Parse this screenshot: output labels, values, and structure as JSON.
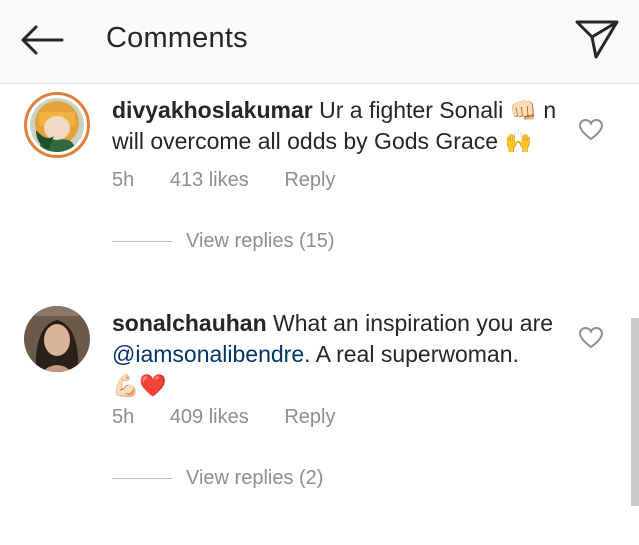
{
  "header": {
    "title": "Comments"
  },
  "comments": [
    {
      "username": "divyakhoslakumar",
      "text_before": "Ur a fighter Sonali ",
      "emoji1": "👊🏻",
      "text_after": " n will overcome all odds by Gods Grace ",
      "emoji2": "🙌",
      "time": "5h",
      "likes": "413 likes",
      "reply": "Reply",
      "view_replies": "View replies (15)"
    },
    {
      "username": "sonalchauhan",
      "text": "What an inspiration you are ",
      "mention": "@iamsonalibendre",
      "text_after": ". A real superwoman.",
      "emojis": "💪🏻❤️",
      "time": "5h",
      "likes": "409 likes",
      "reply": "Reply",
      "view_replies": "View replies (2)"
    }
  ]
}
